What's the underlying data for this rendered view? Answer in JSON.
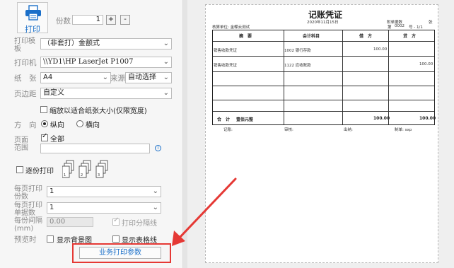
{
  "left": {
    "print_button_label": "打印",
    "copies_label": "份数",
    "copies_value": "1",
    "plus_label": "+",
    "minus_label": "-",
    "template_label": "打印模板",
    "template_value": "（非套打）金额式",
    "printer_label": "打印机",
    "printer_value": "\\\\YD1\\HP LaserJet P1007",
    "paper_label": "纸　张",
    "paper_value": "A4",
    "source_label": "来源",
    "source_value": "自动选择",
    "margin_label": "页边距",
    "margin_value": "自定义",
    "shrink_label": "缩放以适合纸张大小(仅限宽度)",
    "direction_label": "方　向",
    "portrait_label": "纵向",
    "landscape_label": "横向",
    "page_range_label": "页面范围",
    "all_label": "全部",
    "collate_label": "逐份打印",
    "per_page_copies_label": "每页打印份数",
    "per_page_copies_value": "1",
    "per_page_docs_label": "每页打印单据数",
    "per_page_docs_value": "1",
    "spacing_label": "每份间隔(mm)",
    "spacing_value": "0.00",
    "separator_label": "打印分隔线",
    "preview_label": "预览时",
    "bg_label": "显示背景图",
    "grid_label": "显示表格线",
    "business_button_label": "业务打印参数"
  },
  "voucher": {
    "title": "记账凭证",
    "date": "2020年11月15日",
    "attach": "附单据数",
    "attach_unit": "张",
    "company": "核算单位: 金蝶云测试",
    "no_label": "第",
    "no_value": "0002",
    "no_suffix": "号 - 1/1",
    "headers": [
      "摘　要",
      "会计科目",
      "借　方",
      "贷　方"
    ],
    "rows": [
      {
        "summary": "销售收款凭证",
        "account": "1002 银行存款",
        "debit": "100.00",
        "credit": ""
      },
      {
        "summary": "销售收款凭证",
        "account": "1122 应收账款",
        "debit": "",
        "credit": "100.00"
      }
    ],
    "total_label": "合　计",
    "total_text": "壹佰元整",
    "total_debit": "100.00",
    "total_credit": "100.00",
    "footer": [
      "记账:",
      "审核:",
      "出纳:",
      "制单: sxp"
    ]
  },
  "colors": {
    "accent": "#1a6fc9",
    "annotation": "#e53935"
  }
}
